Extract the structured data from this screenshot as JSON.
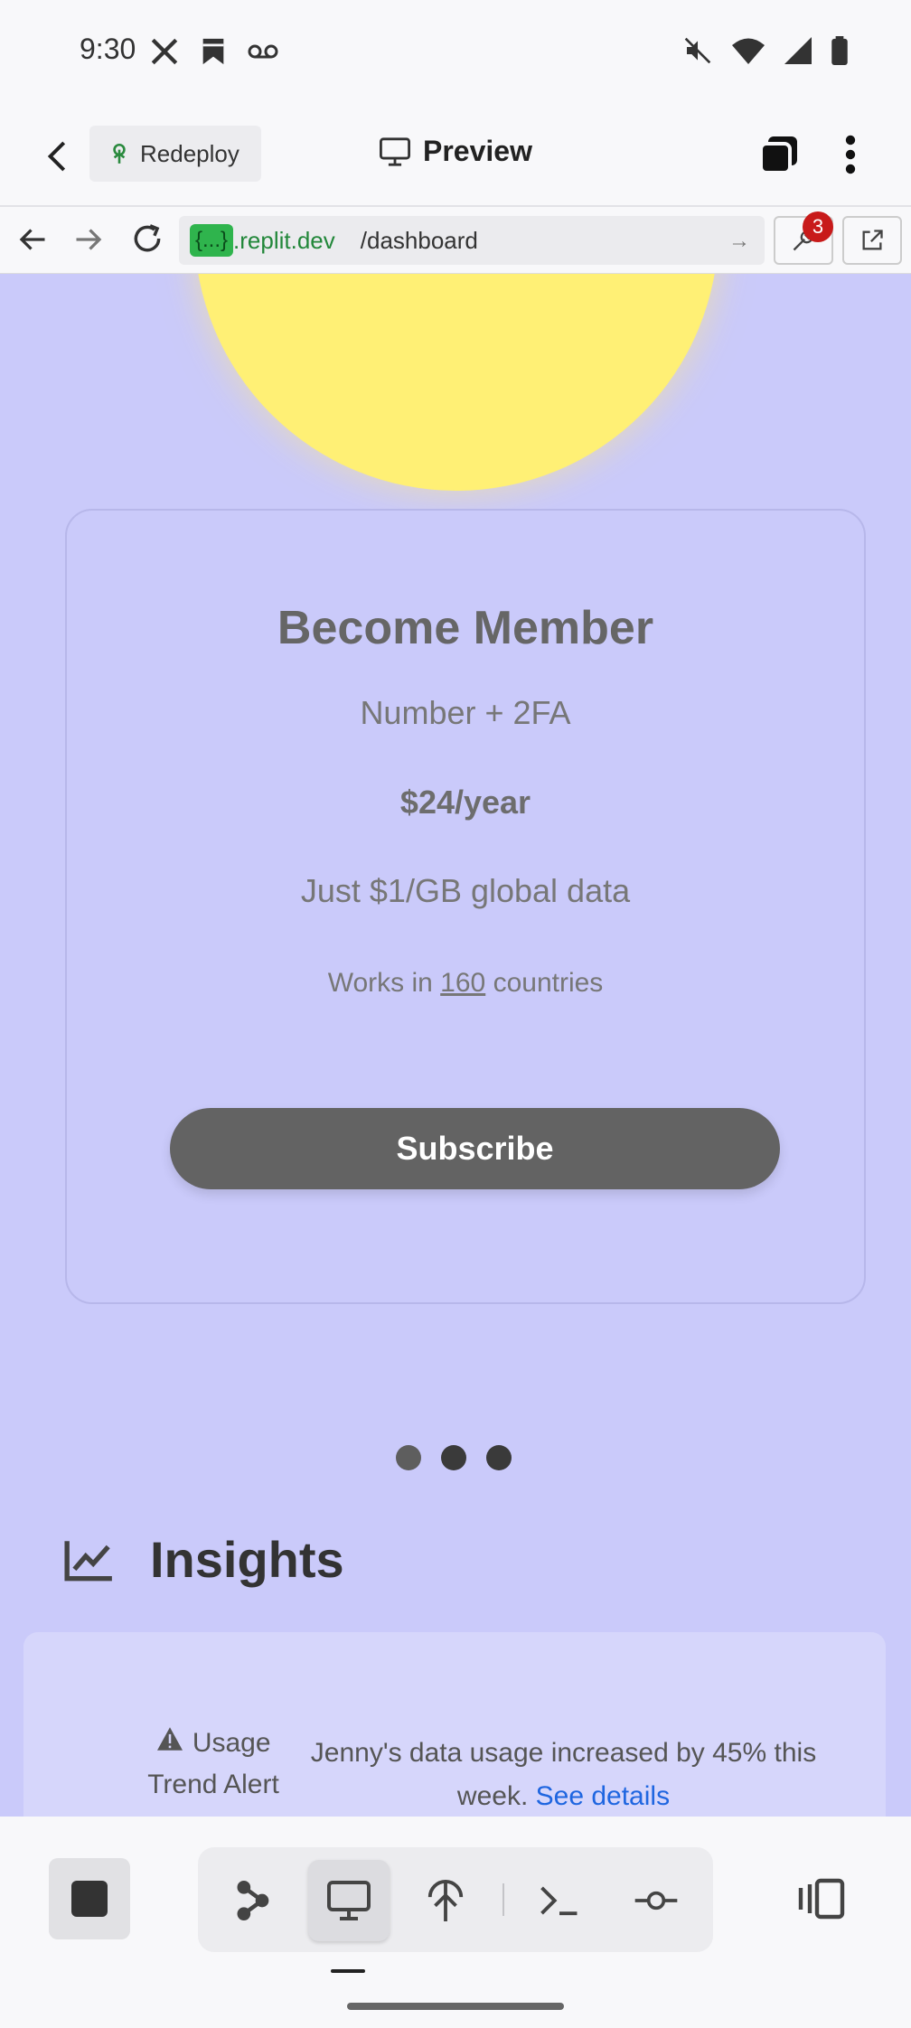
{
  "status_bar": {
    "time": "9:30",
    "left_icons": [
      "x-icon",
      "bookmark-icon",
      "voicemail-icon"
    ],
    "right_icons": [
      "mute-icon",
      "wifi-icon",
      "signal-icon",
      "battery-icon"
    ]
  },
  "app_bar": {
    "redeploy_label": "Redeploy",
    "title": "Preview"
  },
  "browser": {
    "url_badge": "{...}",
    "url_domain": ".replit.dev",
    "url_path": "/dashboard",
    "devtools_badge": "3"
  },
  "card": {
    "title": "Become Member",
    "subtitle": "Number + 2FA",
    "price": "$24/year",
    "data_line": "Just $1/GB global data",
    "countries_prefix": "Works in",
    "countries_count": "160",
    "countries_suffix": "countries",
    "subscribe_label": "Subscribe"
  },
  "carousel": {
    "count": 3,
    "active": 0
  },
  "insights": {
    "title": "Insights",
    "alert_label_1": "Usage",
    "alert_label_2": "Trend Alert",
    "alert_text": "Jenny's data usage increased by 45% this week.",
    "alert_link": "See details"
  },
  "colors": {
    "page_bg": "#cacafa",
    "sun": "#fff075",
    "subscribe_bg": "#636363",
    "link": "#1f66e0",
    "badge": "#c81a1a"
  }
}
